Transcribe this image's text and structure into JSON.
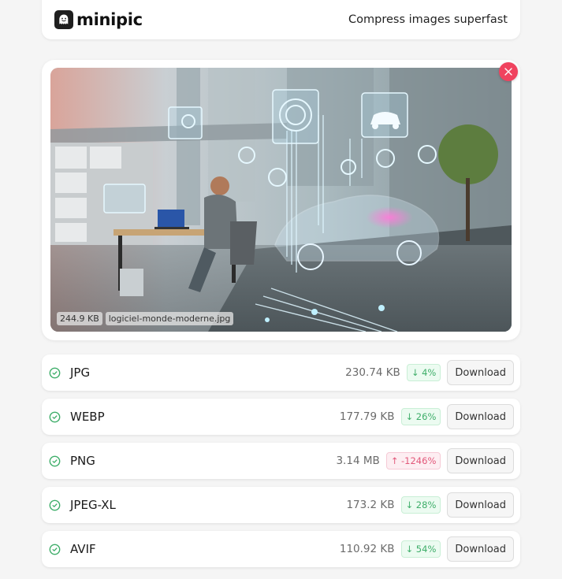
{
  "header": {
    "brand": "minipic",
    "tagline": "Compress images superfast",
    "logo_icon": "ghost-smile-icon"
  },
  "image": {
    "size": "244.9 KB",
    "filename": "logiciel-monde-moderne.jpg",
    "close_icon": "close-icon"
  },
  "colors": {
    "success": "#3fae6a",
    "danger": "#e2587a",
    "close": "#f0435f"
  },
  "results": [
    {
      "format": "JPG",
      "size": "230.74 KB",
      "change": "↓ 4%",
      "direction": "down",
      "button": "Download"
    },
    {
      "format": "WEBP",
      "size": "177.79 KB",
      "change": "↓ 26%",
      "direction": "down",
      "button": "Download"
    },
    {
      "format": "PNG",
      "size": "3.14 MB",
      "change": "↑ -1246%",
      "direction": "up",
      "button": "Download"
    },
    {
      "format": "JPEG-XL",
      "size": "173.2 KB",
      "change": "↓ 28%",
      "direction": "down",
      "button": "Download"
    },
    {
      "format": "AVIF",
      "size": "110.92 KB",
      "change": "↓ 54%",
      "direction": "down",
      "button": "Download"
    }
  ]
}
